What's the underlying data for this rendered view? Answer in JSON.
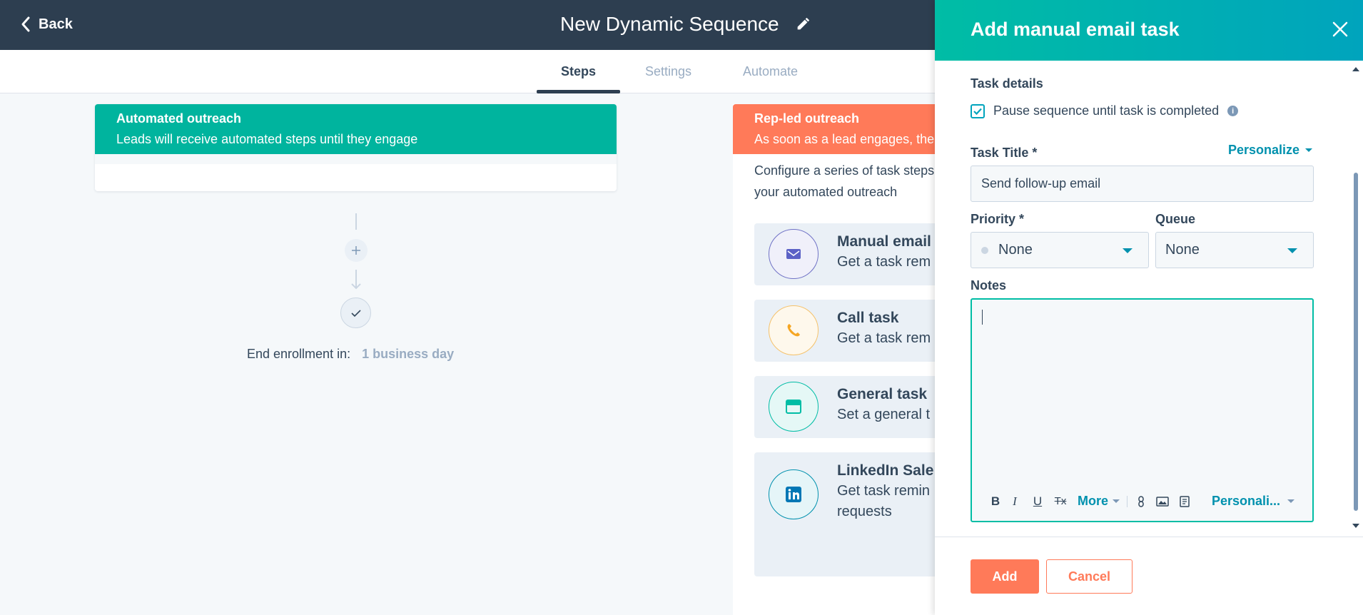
{
  "header": {
    "back_label": "Back",
    "title": "New Dynamic Sequence",
    "edit_icon": "pencil-icon"
  },
  "tabs": [
    {
      "label": "Steps",
      "active": true
    },
    {
      "label": "Settings",
      "active": false
    },
    {
      "label": "Automate",
      "active": false
    }
  ],
  "automated": {
    "title": "Automated outreach",
    "subtitle": "Leads will receive automated steps until they engage",
    "color": "#00b49e"
  },
  "flow": {
    "end_label": "End enrollment in:",
    "end_value": "1 business day"
  },
  "rep_led": {
    "title": "Rep-led outreach",
    "subtitle": "As soon as a lead engages, the",
    "description_line1": "Configure a series of task steps",
    "description_line2": "your automated outreach",
    "color": "#ff7a59",
    "options": [
      {
        "name": "Manual email",
        "desc": "Get a task rem",
        "icon": "envelope-icon"
      },
      {
        "name": "Call task",
        "desc": "Get a task rem",
        "icon": "phone-icon"
      },
      {
        "name": "General task",
        "desc": "Set a general t",
        "icon": "window-icon"
      },
      {
        "name": "LinkedIn Sale",
        "desc_line1": "Get task remin",
        "desc_line2": "requests",
        "icon": "linkedin-icon"
      }
    ]
  },
  "panel": {
    "title": "Add manual email task",
    "section_label": "Task details",
    "pause_checkbox_label": "Pause sequence until task is completed",
    "pause_checked": true,
    "task_title_label": "Task Title *",
    "personalize_label": "Personalize",
    "task_title_value": "Send follow-up email",
    "priority_label": "Priority *",
    "priority_value": "None",
    "queue_label": "Queue",
    "queue_value": "None",
    "notes_label": "Notes",
    "notes_value": "",
    "toolbar": {
      "bold": "B",
      "italic": "I",
      "underline": "U",
      "clear_format": "Tx",
      "more": "More",
      "personalize": "Personali..."
    },
    "add_button": "Add",
    "cancel_button": "Cancel",
    "accent_color": "#00a4bd"
  }
}
